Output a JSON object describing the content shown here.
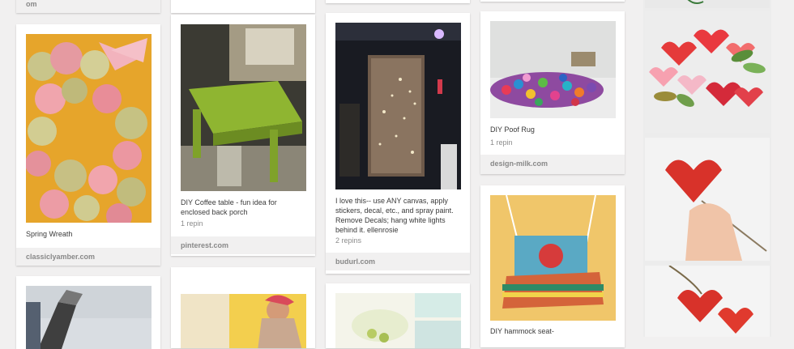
{
  "colors": {
    "background": "#f1f0f0",
    "card": "#ffffff",
    "source_bar": "#f1f0f0",
    "link_gray": "#888888"
  },
  "pins": [
    {
      "description": "Spring Wreath",
      "source": "classiclyamber.com"
    },
    {
      "description": "DIY Coffee table - fun idea for enclosed back porch",
      "repins": "1 repin",
      "source": "pinterest.com"
    },
    {
      "description": "I love this-- use ANY canvas, apply stickers, decal, etc., and spray paint. Remove Decals; hang white lights behind it. ellenrosie",
      "repins": "2 repins",
      "source": "budurl.com"
    },
    {
      "description": "DIY Poof Rug",
      "repins": "1 repin",
      "source": "design-milk.com"
    },
    {
      "description": "DIY hammock seat-"
    }
  ],
  "partial_top_source": "om"
}
